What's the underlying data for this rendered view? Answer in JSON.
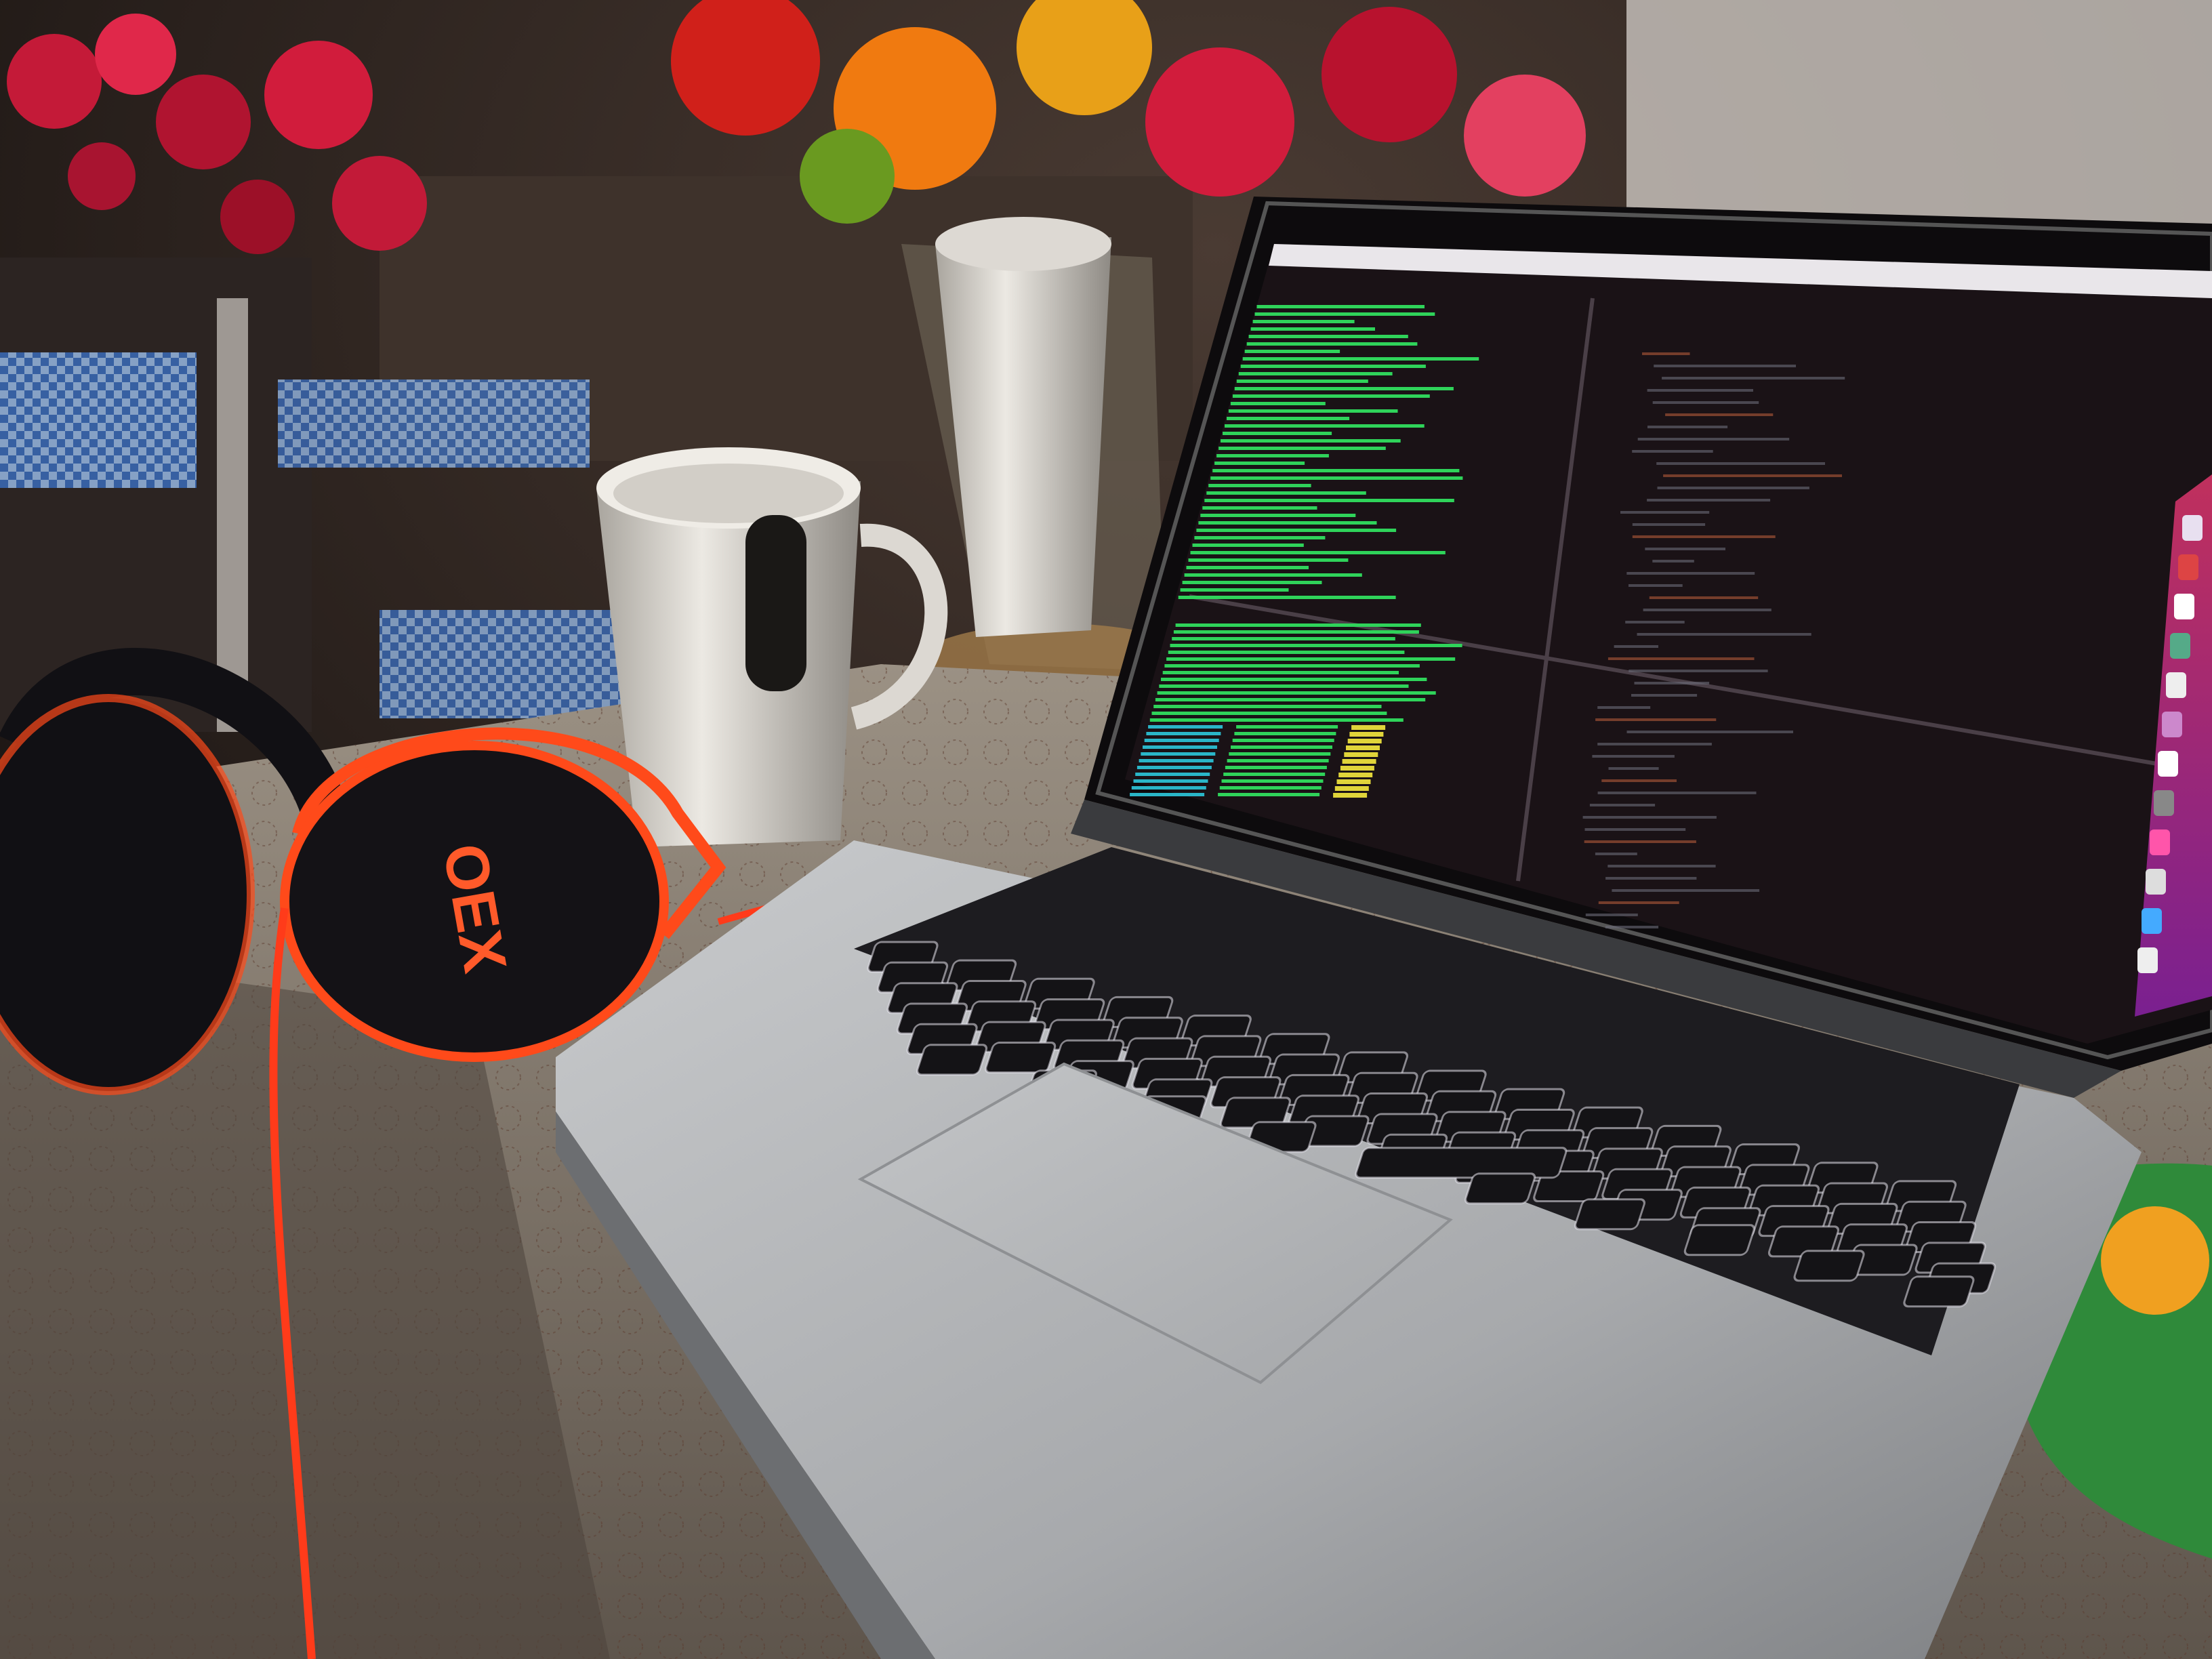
{
  "scene": {
    "description_free": true,
    "headphones_brand": "OEX"
  },
  "palette": {
    "room_dark": "#1b1512",
    "wall_warm": "#3a2f29",
    "tablecloth": "#8c8275",
    "tablecloth_shadow": "#4d443c",
    "laptop_silver": "#b4b6b8",
    "laptop_shadow": "#7b7d80",
    "keyboard_key": "#141316",
    "key_glow": "#e8e6ef",
    "screen_bg": "#1a1216",
    "terminal_green": "#2fd35a",
    "terminal_cyan": "#2ab6c8",
    "terminal_yellow": "#e0d43a",
    "menubar": "#e9e6ea",
    "dock_purple": "#9b2ea6",
    "flower_red": "#d11c3c",
    "flower_orange": "#f07a10",
    "headphone_black": "#111014",
    "headphone_orange": "#ff4a1a",
    "mug_white": "#e8e5df",
    "checker_blue": "#3a6fc2"
  },
  "icons": {
    "laptop": "laptop-icon",
    "headphones": "headphones-icon",
    "mug": "mug-icon"
  }
}
